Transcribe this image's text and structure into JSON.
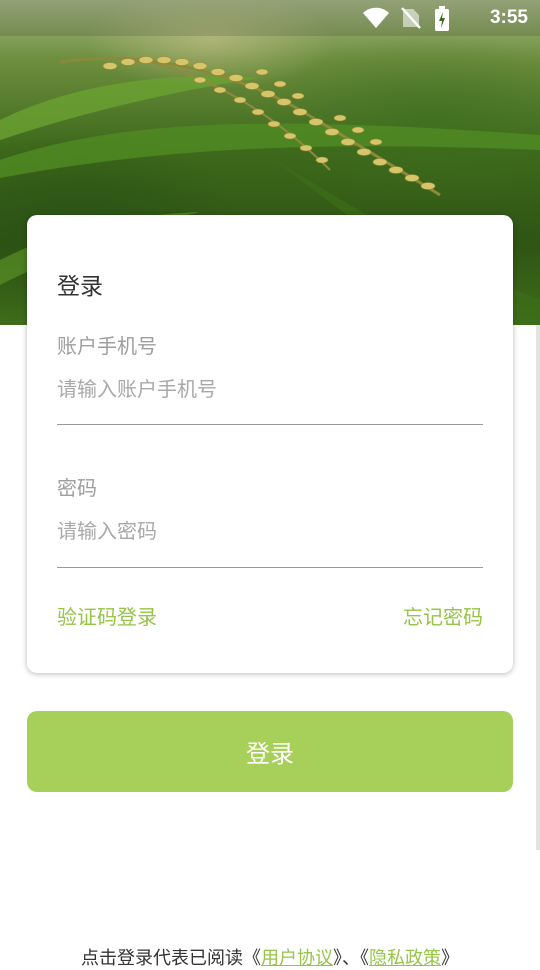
{
  "status_bar": {
    "time": "3:55",
    "icons": [
      "wifi-icon",
      "no-sim-icon",
      "battery-charging-icon"
    ]
  },
  "login_card": {
    "title": "登录",
    "account": {
      "label": "账户手机号",
      "placeholder": "请输入账户手机号",
      "value": ""
    },
    "password": {
      "label": "密码",
      "placeholder": "请输入密码",
      "value": ""
    },
    "sms_login_link": "验证码登录",
    "forgot_password_link": "忘记密码"
  },
  "login_button": "登录",
  "agreement": {
    "prefix": "点击登录代表已阅读",
    "open_quote_1": "《",
    "user_agreement": "用户协议",
    "close_quote_1": "》",
    "separator": "、",
    "open_quote_2": "《",
    "privacy_policy": "隐私政策",
    "close_quote_2": "》"
  },
  "colors": {
    "accent": "#a7d05a",
    "link": "#96c447",
    "label": "#9e9e9e"
  }
}
